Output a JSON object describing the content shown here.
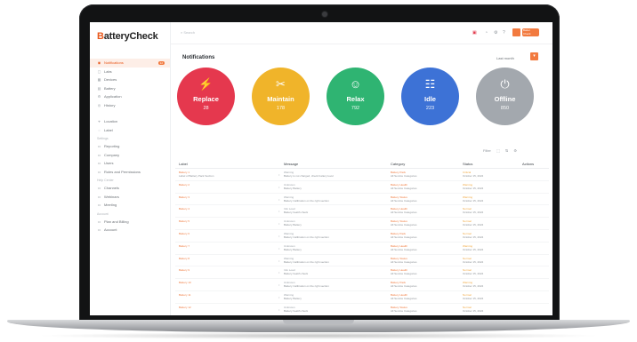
{
  "app": {
    "logo_b": "B",
    "logo_rest": "atteryCheck"
  },
  "topbar": {
    "search_placeholder": "Search",
    "user_chip": "Batter Check"
  },
  "sidebar": {
    "groups": [
      {
        "label": "",
        "items": [
          {
            "icon": "◉",
            "label": "Notifications",
            "badge": "12",
            "active": true
          },
          {
            "icon": "▢",
            "label": "Labs"
          },
          {
            "icon": "▦",
            "label": "Devices"
          },
          {
            "icon": "▤",
            "label": "Battery"
          },
          {
            "icon": "⚙",
            "label": "Application"
          },
          {
            "icon": "◎",
            "label": "History"
          }
        ]
      },
      {
        "label": "",
        "items": [
          {
            "icon": "⌖",
            "label": "Location"
          },
          {
            "icon": "◌",
            "label": "Label"
          }
        ]
      },
      {
        "label": "Settings",
        "items": [
          {
            "icon": "▭",
            "label": "Reporting"
          },
          {
            "icon": "▭",
            "label": "Company"
          },
          {
            "icon": "▭",
            "label": "Users"
          },
          {
            "icon": "▭",
            "label": "Roles and Permissions"
          }
        ]
      },
      {
        "label": "Help Center",
        "items": [
          {
            "icon": "▭",
            "label": "Channels"
          },
          {
            "icon": "▭",
            "label": "Webinars"
          },
          {
            "icon": "▭",
            "label": "Meeting"
          }
        ]
      },
      {
        "label": "Account",
        "items": [
          {
            "icon": "▭",
            "label": "Plan and Billing"
          },
          {
            "icon": "▭",
            "label": "Account"
          }
        ]
      }
    ]
  },
  "page": {
    "title": "Notifications",
    "filter": "Last month",
    "filter_button": "▾"
  },
  "summary": [
    {
      "label": "Replace",
      "value": "28",
      "icon": "⚡",
      "color": "#e5384e"
    },
    {
      "label": "Maintain",
      "value": "178",
      "icon": "✂",
      "color": "#f0b42a"
    },
    {
      "label": "Relax",
      "value": "792",
      "icon": "☺",
      "color": "#2fb472"
    },
    {
      "label": "Idle",
      "value": "223",
      "icon": "☷",
      "color": "#3d72d6"
    },
    {
      "label": "Offline",
      "value": "850",
      "icon": "⏻",
      "color": "#a3a8ae"
    }
  ],
  "table_tools": {
    "label": "Filter",
    "icons": [
      "⬚",
      "⇅",
      "⚙"
    ]
  },
  "table": {
    "columns": [
      "Label",
      "Message",
      "Category",
      "Status",
      "Actions"
    ],
    "rows": [
      {
        "label": [
          "Battery 1",
          "Label of Battery Pack Section"
        ],
        "message": [
          "Warning",
          "Battery is not charged, check battery level"
        ],
        "category": [
          "Battery Pack",
          "All Service Categories"
        ],
        "status": [
          "Critical",
          "October 15, 2024"
        ]
      },
      {
        "label": [
          "Battery 2",
          ""
        ],
        "message": [
          "Unknown",
          "Battery Battery"
        ],
        "category": [
          "Battery Health",
          "All Service Categories"
        ],
        "status": [
          "Warning",
          "October 15, 2024"
        ]
      },
      {
        "label": [
          "Battery 3",
          ""
        ],
        "message": [
          "Warning",
          "Battery Calibration on the right section"
        ],
        "category": [
          "Battery Status",
          "All Service Categories"
        ],
        "status": [
          "Warning",
          "October 15, 2024"
        ]
      },
      {
        "label": [
          "Battery 4",
          ""
        ],
        "message": [
          "Info Load",
          "Battery health check"
        ],
        "category": [
          "Battery Health",
          "All Service Categories"
        ],
        "status": [
          "Normal",
          "October 15, 2024"
        ]
      },
      {
        "label": [
          "Battery 5",
          ""
        ],
        "message": [
          "Unknown",
          "Battery Battery"
        ],
        "category": [
          "Battery Status",
          "All Service Categories"
        ],
        "status": [
          "Normal",
          "October 15, 2024"
        ]
      },
      {
        "label": [
          "Battery 6",
          ""
        ],
        "message": [
          "Warning",
          "Battery Calibration on the right section"
        ],
        "category": [
          "Battery Pack",
          "All Service Categories"
        ],
        "status": [
          "Normal",
          "October 15, 2024"
        ]
      },
      {
        "label": [
          "Battery 7",
          ""
        ],
        "message": [
          "Unknown",
          "Battery Battery"
        ],
        "category": [
          "Battery Health",
          "All Service Categories"
        ],
        "status": [
          "Warning",
          "October 15, 2024"
        ]
      },
      {
        "label": [
          "Battery 8",
          ""
        ],
        "message": [
          "Warning",
          "Battery Calibration on the right section"
        ],
        "category": [
          "Battery Status",
          "All Service Categories"
        ],
        "status": [
          "Normal",
          "October 15, 2024"
        ]
      },
      {
        "label": [
          "Battery 9",
          ""
        ],
        "message": [
          "Info Load",
          "Battery health check"
        ],
        "category": [
          "Battery Health",
          "All Service Categories"
        ],
        "status": [
          "Normal",
          "October 15, 2024"
        ]
      },
      {
        "label": [
          "Battery 10",
          ""
        ],
        "message": [
          "Unknown",
          "Battery Calibration on the right section"
        ],
        "category": [
          "Battery Pack",
          "All Service Categories"
        ],
        "status": [
          "Warning",
          "October 15, 2024"
        ]
      },
      {
        "label": [
          "Battery 11",
          ""
        ],
        "message": [
          "Warning",
          "Battery Battery"
        ],
        "category": [
          "Battery Health",
          "All Service Categories"
        ],
        "status": [
          "Normal",
          "October 15, 2024"
        ]
      },
      {
        "label": [
          "Battery 12",
          ""
        ],
        "message": [
          "Unknown",
          "Battery health check"
        ],
        "category": [
          "Battery Status",
          "All Service Categories"
        ],
        "status": [
          "Normal",
          "October 15, 2024"
        ]
      }
    ]
  }
}
